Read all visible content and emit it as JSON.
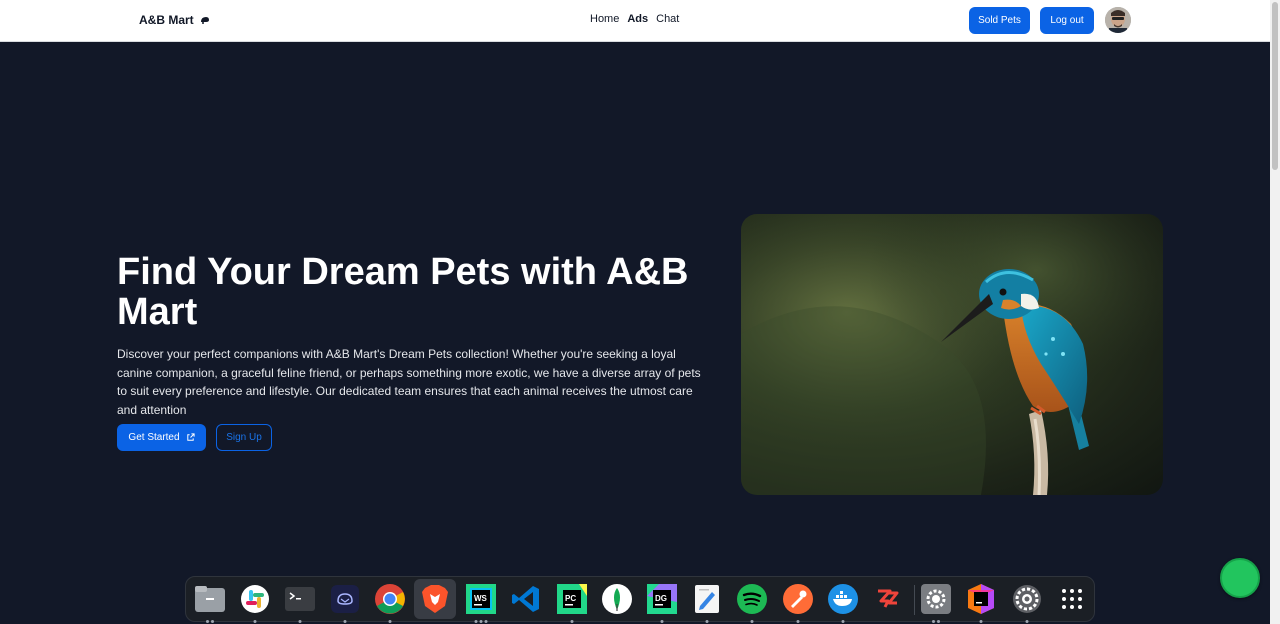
{
  "navbar": {
    "brand": "A&B Mart",
    "links": [
      {
        "label": "Home",
        "active": false
      },
      {
        "label": "Ads",
        "active": true
      },
      {
        "label": "Chat",
        "active": false
      }
    ],
    "sold_pets_label": "Sold Pets",
    "logout_label": "Log out",
    "accent_color": "#0b63e5"
  },
  "hero": {
    "title": "Find Your Dream Pets with A&B Mart",
    "description": "Discover your perfect companions with A&B Mart's Dream Pets collection! Whether you're seeking a loyal canine companion, a graceful feline friend, or perhaps something more exotic, we have a diverse array of pets to suit every preference and lifestyle. Our dedicated team ensures that each animal receives the utmost care and attention",
    "get_started_label": "Get Started",
    "signup_label": "Sign Up"
  },
  "dock": {
    "apps": [
      "files-icon",
      "slack-icon",
      "terminal-icon",
      "mailspring-icon",
      "chrome-icon",
      "brave-icon",
      "webstorm-icon",
      "vscode-icon",
      "pycharm-icon",
      "mongodb-compass-icon",
      "datagrip-icon",
      "text-editor-icon",
      "spotify-icon",
      "postman-icon",
      "docker-icon",
      "anydesk-icon",
      "settings-icon",
      "jetbrains-toolbox-icon",
      "system-settings-icon",
      "app-grid-icon"
    ]
  },
  "colors": {
    "background": "#121828",
    "primary": "#0b63e5",
    "fab": "#22c55e"
  }
}
